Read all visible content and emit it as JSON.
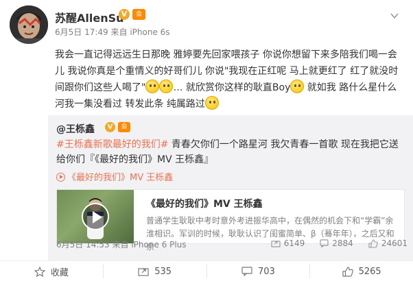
{
  "post": {
    "username": "苏醒AllenSu",
    "verified_badge": "V",
    "member_badge": "会",
    "date": "6月5日 17:49",
    "source": "来自 iPhone 6s",
    "text_part1": "我会一直记得远远生日那晚 雅婷要先回家喂孩子 你说你想留下来多陪我们喝一会儿 我说你真是个重情义的好哥们儿 你说\"我现在正红呢 马上就更红了 红了就没时间跟你们这些人喝了\"",
    "text_part2": "… 就欣赏你这样的耿直Boy",
    "text_part3": " 就如我 路什么星什么河我一集没看过 转发此条 纯属路过"
  },
  "repost": {
    "username": "@王栎鑫",
    "verified_badge": "V",
    "member_badge": "会",
    "hashtag": "#王栎鑫新歌最好的我们#",
    "text": " 青春欠你们一个路星河 我欠青春一首歌 现在我把它送给你们『《最好的我们》MV 王栎鑫』",
    "video_link": "《最好的我们》MV 王栎鑫",
    "video_card": {
      "title": "《最好的我们》MV 王栎鑫",
      "description": "普通学生耿耿中考时意外考进振华高中，在偶然的机会下和“学霸”余淮相识。军训的时候，耿耿认识了闺蜜简单、β（蓦年年），之后又和余"
    },
    "date": "6月5日 14:53",
    "source": "来自 iPhone 6 Plus",
    "stats": {
      "reposts": "6149",
      "comments": "2884",
      "likes": "24601"
    }
  },
  "actions": {
    "favorite": "收藏",
    "repost": "535",
    "comment": "703",
    "like": "5265"
  },
  "colors": {
    "link": "#eb7350",
    "meta": "#808080",
    "badge": "#f5a623",
    "repost_bg": "#f2f2f5"
  }
}
